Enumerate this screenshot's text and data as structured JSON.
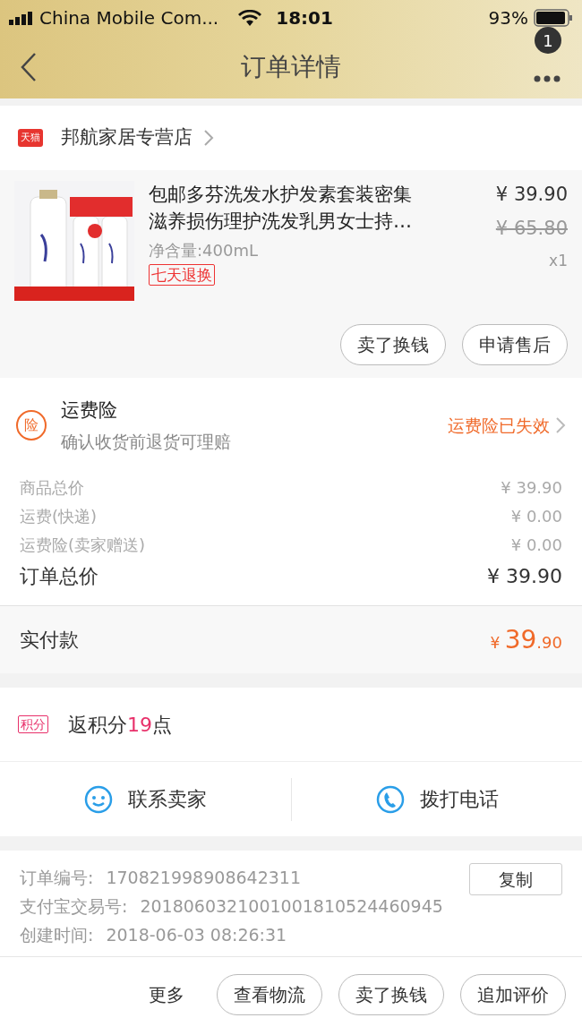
{
  "status_bar": {
    "carrier": "China Mobile Com...",
    "time": "18:01",
    "battery": "93%"
  },
  "nav": {
    "title": "订单详情",
    "badge": "1"
  },
  "store": {
    "badge": "天猫",
    "name": "邦航家居专营店"
  },
  "product": {
    "title": "包邮多芬洗发水护发素套装密集滋养损伤理护洗发乳男女士持…",
    "spec": "净含量:400mL",
    "tag": "七天退换",
    "price": "¥ 39.90",
    "original_price": "¥ 65.80",
    "quantity": "x1",
    "buttons": [
      "卖了换钱",
      "申请售后"
    ]
  },
  "insurance": {
    "icon": "险",
    "title": "运费险",
    "subtitle": "确认收货前退货可理赔",
    "status": "运费险已失效"
  },
  "price_lines": [
    {
      "kind": "minor",
      "label": "商品总价",
      "value": "¥ 39.90"
    },
    {
      "kind": "minor",
      "label": "运费(快递)",
      "value": "¥ 0.00"
    },
    {
      "kind": "minor",
      "label": "运费险(卖家赠送)",
      "value": "¥ 0.00"
    },
    {
      "kind": "total",
      "label": "订单总价",
      "value": "¥ 39.90"
    }
  ],
  "paid": {
    "label": "实付款",
    "currency": "¥",
    "integer": "39",
    "decimals": ".90"
  },
  "points": {
    "badge": "积分",
    "prefix": "返积分",
    "amount": "19",
    "suffix": "点"
  },
  "contact": [
    {
      "kind": "chat",
      "label": "联系卖家"
    },
    {
      "kind": "phone",
      "label": "拨打电话"
    }
  ],
  "order_info": {
    "rows": [
      {
        "label": "订单编号:",
        "value": "170821998908642311"
      },
      {
        "label": "支付宝交易号:",
        "value": "2018060321001001810524460945"
      },
      {
        "label": "创建时间:",
        "value": "2018-06-03 08:26:31"
      }
    ],
    "copy_button": "复制"
  },
  "bottom_bar": {
    "more": "更多",
    "buttons": [
      "查看物流",
      "卖了换钱",
      "追加评价"
    ]
  }
}
